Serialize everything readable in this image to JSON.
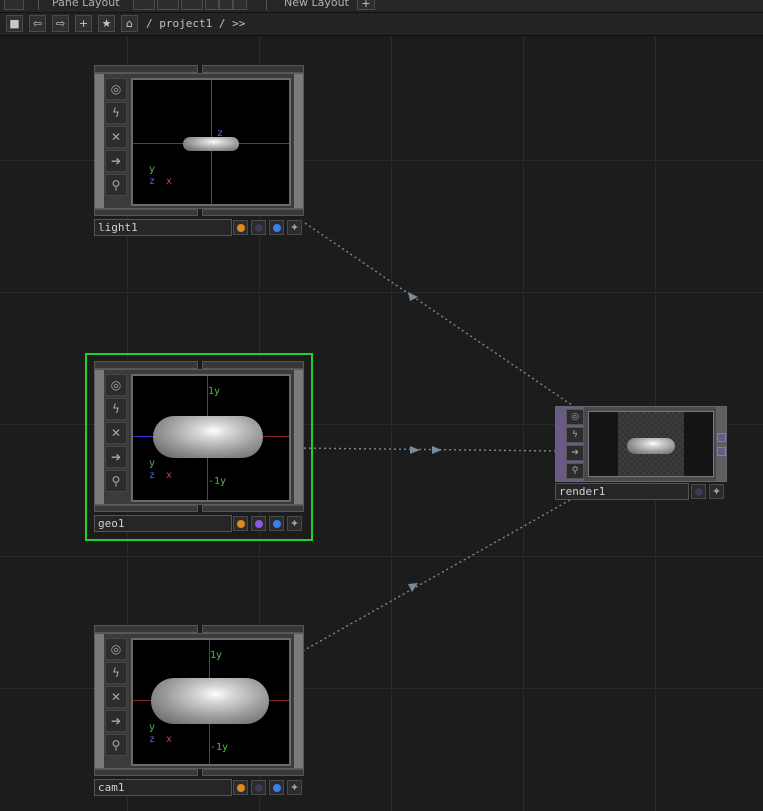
{
  "topbar": {
    "pane_layout_label": "Pane Layout",
    "new_layout_label": "New Layout",
    "new_layout_add": "+"
  },
  "pathbar": {
    "stop_icon": "■",
    "back_icon": "⇦",
    "forward_icon": "⇨",
    "add_icon": "+",
    "star_icon": "★",
    "home_icon": "⌂",
    "path": "/ project1 / >>"
  },
  "nodes": {
    "light1": {
      "name": "light1",
      "viewer_labels": {
        "z": "z",
        "y": "y",
        "x": "x",
        "gz": "z"
      }
    },
    "geo1": {
      "name": "geo1",
      "viewer_labels": {
        "top": "1y",
        "bottom": "-1y",
        "y": "y",
        "x": "x",
        "z": "z"
      }
    },
    "cam1": {
      "name": "cam1",
      "viewer_labels": {
        "top": "1y",
        "bottom": "-1y",
        "y": "y",
        "x": "x",
        "z": "z"
      }
    },
    "render1": {
      "name": "render1"
    }
  },
  "flags": {
    "viewer": "◎",
    "cook": "ϟ",
    "bypass": "✕",
    "display": "➔",
    "lock": "⚲",
    "plus": "✦"
  },
  "colors": {
    "selection": "#1ed02a",
    "flag_orange": "#e08a1e",
    "flag_purple": "#8a5ae0",
    "flag_blue": "#3b7ee8",
    "flag_dark": "#3a3a55",
    "wire": "#7a8a96",
    "render_accent": "#6a5a86"
  }
}
